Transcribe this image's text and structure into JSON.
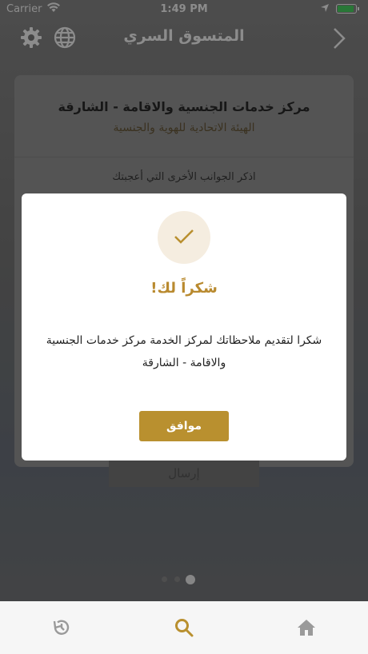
{
  "statusbar": {
    "carrier": "Carrier",
    "time": "1:49 PM"
  },
  "navbar": {
    "title": "المتسوق السري"
  },
  "card": {
    "title": "مركز خدمات الجنسية والاقامة - الشارقة",
    "subtitle": "الهيئة الاتحادية للهوية والجنسية",
    "question": "اذكر الجوانب الأخرى التي أعجبتك"
  },
  "send_button": "إرسال",
  "pager": {
    "total": 3,
    "active": 3
  },
  "modal": {
    "title": "شكراً لك!",
    "message": "شكرا لتقديم ملاحظاتك لمركز الخدمة مركز خدمات الجنسية والاقامة - الشارقة",
    "ok_label": "موافق"
  },
  "tabs": [
    {
      "name": "history",
      "icon": "history-icon"
    },
    {
      "name": "search",
      "icon": "search-icon",
      "active": true
    },
    {
      "name": "home",
      "icon": "home-icon"
    }
  ],
  "colors": {
    "accent": "#b9902f",
    "check_bg": "#f5ede0"
  }
}
